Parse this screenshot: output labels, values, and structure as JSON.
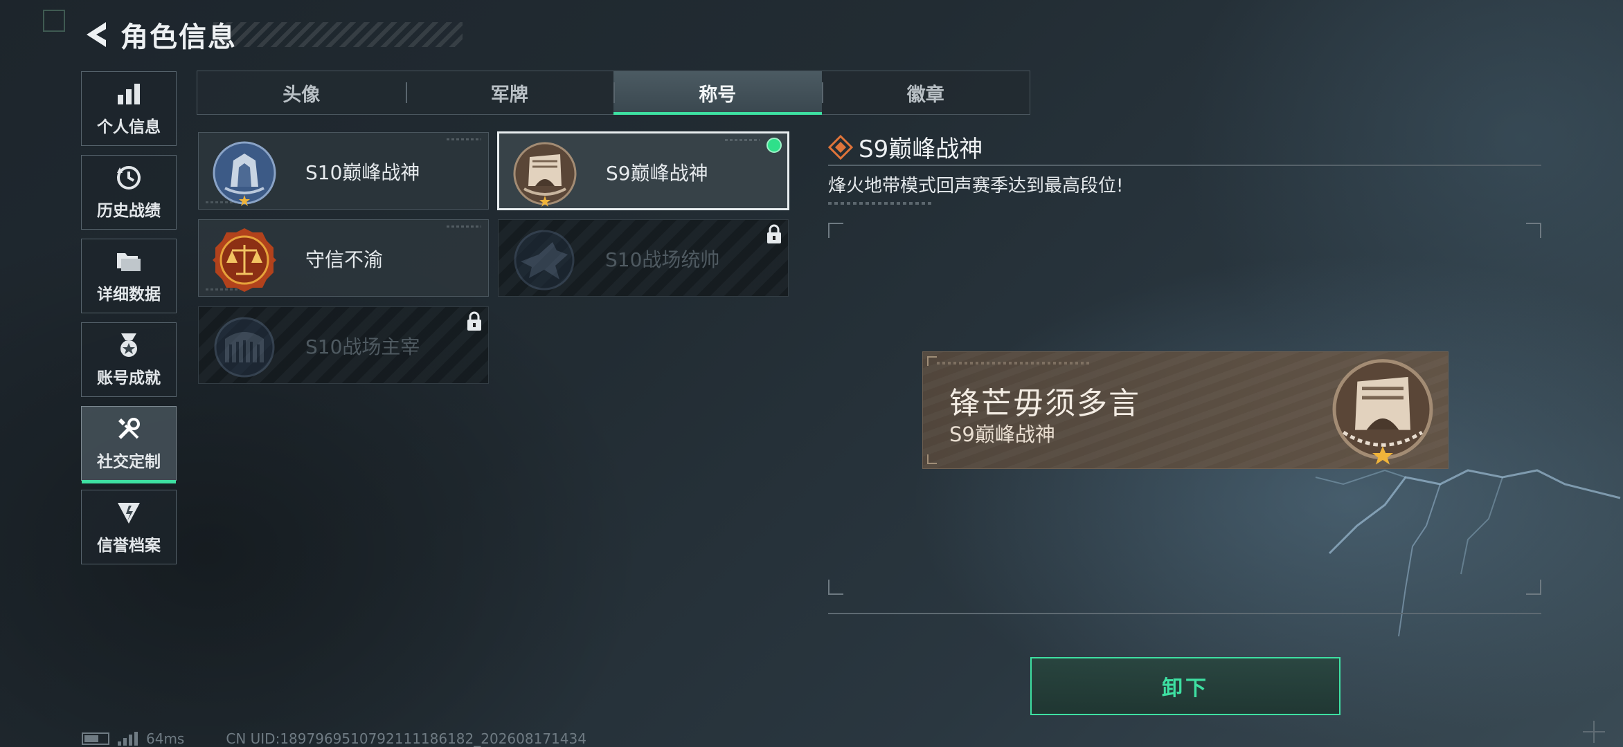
{
  "header": {
    "title": "角色信息"
  },
  "nav": [
    {
      "label": "个人信息",
      "icon": "bar-chart-icon"
    },
    {
      "label": "历史战绩",
      "icon": "history-clock-icon"
    },
    {
      "label": "详细数据",
      "icon": "folder-icon"
    },
    {
      "label": "账号成就",
      "icon": "medal-icon"
    },
    {
      "label": "社交定制",
      "icon": "wrench-screwdriver-icon",
      "active": true
    },
    {
      "label": "信誉档案",
      "icon": "shield-emblem-icon"
    }
  ],
  "tabs": [
    {
      "label": "头像"
    },
    {
      "label": "军牌"
    },
    {
      "label": "称号",
      "active": true
    },
    {
      "label": "徽章"
    }
  ],
  "titles": [
    {
      "label": "S10巅峰战神",
      "state": "unlocked"
    },
    {
      "label": "S9巅峰战神",
      "state": "selected-equipped"
    },
    {
      "label": "守信不渝",
      "state": "unlocked"
    },
    {
      "label": "S10战场统帅",
      "state": "locked"
    },
    {
      "label": "S10战场主宰",
      "state": "locked"
    }
  ],
  "detail": {
    "title": "S9巅峰战神",
    "description": "烽火地带模式回声赛季达到最高段位!"
  },
  "preview": {
    "main": "锋芒毋须多言",
    "sub": "S9巅峰战神"
  },
  "actions": {
    "unequip_label": "卸下"
  },
  "status_bar": {
    "ping": "64ms",
    "uid": "CN UID:1897969510792111186182_202608171434"
  },
  "colors": {
    "accent": "#3ee0a2",
    "equipped": "#2fe08a",
    "title_orange": "#e0743a"
  }
}
